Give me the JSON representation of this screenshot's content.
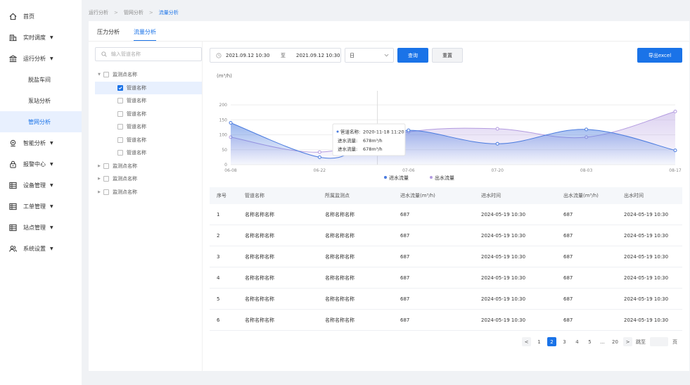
{
  "sidebar": {
    "items": [
      {
        "label": "首页",
        "icon": "home-icon"
      },
      {
        "label": "实时调度",
        "icon": "building-icon",
        "caret": "▼"
      },
      {
        "label": "运行分析",
        "icon": "bank-icon",
        "caret": "▼"
      },
      {
        "label": "智能分析",
        "icon": "location-icon",
        "caret": "▼"
      },
      {
        "label": "报警中心",
        "icon": "lock-icon",
        "caret": "▼"
      },
      {
        "label": "设备管理",
        "icon": "grid-icon",
        "caret": "▼"
      },
      {
        "label": "工单管理",
        "icon": "grid-icon",
        "caret": "▼"
      },
      {
        "label": "站点管理",
        "icon": "grid-icon",
        "caret": "▼"
      },
      {
        "label": "系统设置",
        "icon": "users-icon",
        "caret": "▼"
      }
    ],
    "sub_items": [
      "脱盐车间",
      "泵站分析",
      "管网分析"
    ]
  },
  "breadcrumb": [
    "运行分析",
    "管网分析",
    "流量分析"
  ],
  "tabs": [
    "压力分析",
    "流量分析"
  ],
  "tree": {
    "search_placeholder": "输入管道名称",
    "nodes": [
      {
        "label": "监测点名称",
        "arrow": "▼",
        "level": 0,
        "checked": false
      },
      {
        "label": "管道名称",
        "level": 1,
        "checked": true,
        "selected": true
      },
      {
        "label": "管道名称",
        "level": 1,
        "checked": false
      },
      {
        "label": "管道名称",
        "level": 1,
        "checked": false
      },
      {
        "label": "管道名称",
        "level": 1,
        "checked": false
      },
      {
        "label": "管道名称",
        "level": 1,
        "checked": false
      },
      {
        "label": "管道名称",
        "level": 1,
        "checked": false
      },
      {
        "label": "监测点名称",
        "arrow": "▶",
        "level": 0,
        "checked": false
      },
      {
        "label": "监测点名称",
        "arrow": "▶",
        "level": 0,
        "checked": false
      },
      {
        "label": "监测点名称",
        "arrow": "▶",
        "level": 0,
        "checked": false
      }
    ]
  },
  "filters": {
    "start_date": "2021.09.12 10:30",
    "to": "至",
    "end_date": "2021.09.12 10:30",
    "granularity": "日",
    "query_label": "查询",
    "reset_label": "重置",
    "export_label": "导出excel"
  },
  "chart_data": {
    "type": "area",
    "ylabel": "(m³/h)",
    "ylim": [
      0,
      200
    ],
    "yticks": [
      0,
      50,
      100,
      150,
      200
    ],
    "x_ticks": [
      "06-08",
      "06-22",
      "07-06",
      "07-20",
      "08-03",
      "08-17"
    ],
    "series": [
      {
        "name": "进水流量",
        "color": "#4a7bdf",
        "points": [
          [
            0,
            140
          ],
          [
            1,
            25
          ],
          [
            1.5,
            60
          ],
          [
            2,
            115
          ],
          [
            3,
            70
          ],
          [
            4,
            118
          ],
          [
            5,
            48
          ]
        ]
      },
      {
        "name": "出水流量",
        "color": "#b39be0",
        "points": [
          [
            0,
            92
          ],
          [
            1,
            42
          ],
          [
            2,
            110
          ],
          [
            3,
            120
          ],
          [
            4,
            92
          ],
          [
            5,
            178
          ]
        ]
      }
    ],
    "tooltip": {
      "line1_label": "管道名称:",
      "line1_value": "2020-11-18  11:20",
      "line2_label": "进水流量:",
      "line2_value": "678m³/h",
      "line3_label": "进水流量:",
      "line3_value": "678m³/h"
    },
    "legend": "bottom-center"
  },
  "table": {
    "headers": [
      "序号",
      "管道名称",
      "所属监测点",
      "进水流量(m³/h)",
      "进水时间",
      "出水流量(m³/h)",
      "出水时间"
    ],
    "rows": [
      [
        "1",
        "名称名称名称",
        "名称名称名称",
        "687",
        "2024-05-19 10:30",
        "687",
        "2024-05-19 10:30"
      ],
      [
        "2",
        "名称名称名称",
        "名称名称名称",
        "687",
        "2024-05-19 10:30",
        "687",
        "2024-05-19 10:30"
      ],
      [
        "3",
        "名称名称名称",
        "名称名称名称",
        "687",
        "2024-05-19 10:30",
        "687",
        "2024-05-19 10:30"
      ],
      [
        "4",
        "名称名称名称",
        "名称名称名称",
        "687",
        "2024-05-19 10:30",
        "687",
        "2024-05-19 10:30"
      ],
      [
        "5",
        "名称名称名称",
        "名称名称名称",
        "687",
        "2024-05-19 10:30",
        "687",
        "2024-05-19 10:30"
      ],
      [
        "6",
        "名称名称名称",
        "名称名称名称",
        "687",
        "2024-05-19 10:30",
        "687",
        "2024-05-19 10:30"
      ]
    ]
  },
  "pagination": {
    "prev": "<",
    "pages": [
      "1",
      "2",
      "3",
      "4",
      "5",
      "...",
      "20"
    ],
    "active": "2",
    "next": ">",
    "jump_label": "跳至",
    "page_unit": "页"
  }
}
